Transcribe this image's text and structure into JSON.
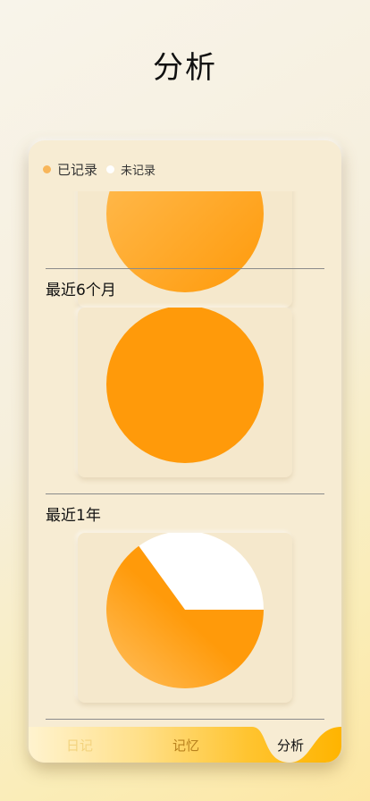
{
  "page": {
    "title": "分析"
  },
  "legend": {
    "recorded": "已记录",
    "unrecorded": "未记录"
  },
  "sections": [
    {
      "title": "最近6个月",
      "recorded_fraction": 1.0
    },
    {
      "title": "最近1年",
      "recorded_fraction": 0.65
    }
  ],
  "tabs": [
    {
      "label": "日记"
    },
    {
      "label": "记忆"
    },
    {
      "label": "分析",
      "active": true
    }
  ],
  "colors": {
    "recorded": "#ff9a0a",
    "unrecorded": "#ffffff",
    "legend_recorded_dot": "#f8b65a",
    "tab_bar": "#ffb800"
  }
}
